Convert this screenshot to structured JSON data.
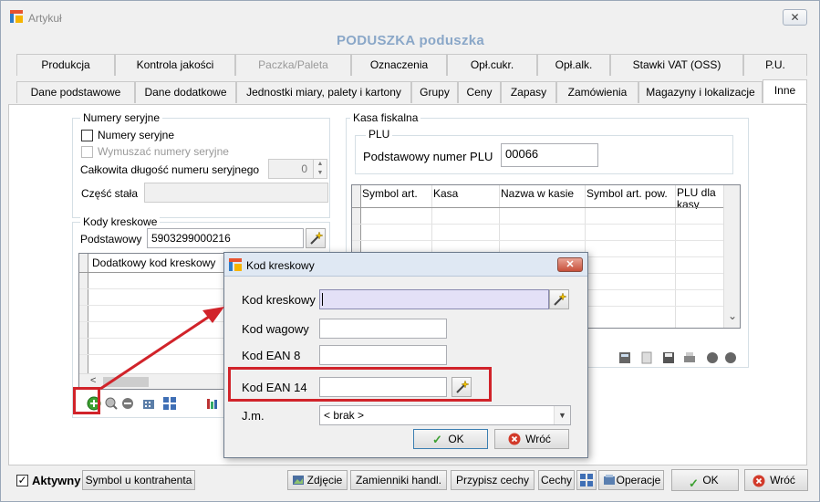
{
  "window": {
    "title": "Artykuł",
    "close_glyph": "✕",
    "product_title": "PODUSZKA  poduszka"
  },
  "tabs_row1": [
    "Produkcja",
    "Kontrola jakości",
    "Paczka/Paleta",
    "Oznaczenia",
    "Opł.cukr.",
    "Opł.alk.",
    "Stawki VAT (OSS)",
    "P.U."
  ],
  "tabs_row2": [
    "Dane podstawowe",
    "Dane dodatkowe",
    "Jednostki miary, palety i kartony",
    "Grupy",
    "Ceny",
    "Zapasy",
    "Zamówienia",
    "Magazyny i lokalizacje",
    "Inne"
  ],
  "serial": {
    "group_title": "Numery seryjne",
    "numery_seryjne_label": "Numery seryjne",
    "wymuszac_label": "Wymuszać numery seryjne",
    "length_label": "Całkowita długość numeru seryjnego",
    "length_value": "0",
    "stala_label": "Część stała",
    "stala_value": ""
  },
  "barcodes": {
    "group_title": "Kody kreskowe",
    "primary_label": "Podstawowy",
    "primary_value": "5903299000216",
    "grid_header": "Dodatkowy kod kreskowy",
    "scroll_left_glyph": "<"
  },
  "fiscal": {
    "group_title": "Kasa fiskalna",
    "plu_group_title": "PLU",
    "plu_label": "Podstawowy numer PLU",
    "plu_value": "00066",
    "columns": [
      "Symbol art.",
      "Kasa",
      "Nazwa w kasie",
      "Symbol art. pow.",
      "PLU dla kasy"
    ],
    "scroll_down_glyph": "⌄"
  },
  "footer": {
    "active_label": "Aktywny",
    "active_checked": true,
    "check_glyph": "✓",
    "symbol_button": "Symbol u kontrahenta",
    "zdjecie_button": "Zdjęcie",
    "zamienniki_button": "Zamienniki handl.",
    "przypisz_button": "Przypisz cechy",
    "cechy_button": "Cechy",
    "operacje_button": "Operacje",
    "ok_button": "OK",
    "wroc_button": "Wróć"
  },
  "dialog": {
    "title": "Kod kreskowy",
    "close_glyph": "✕",
    "kod_kreskowy_label": "Kod kreskowy",
    "kod_kreskowy_value": "",
    "kod_wagowy_label": "Kod wagowy",
    "kod_wagowy_value": "",
    "ean8_label": "Kod EAN 8",
    "ean8_value": "",
    "ean14_label": "Kod EAN 14",
    "ean14_value": "",
    "jm_label": "J.m.",
    "jm_value": "< brak >",
    "ok_button": "OK",
    "wroc_button": "Wróć"
  },
  "colors": {
    "title_blue": "#8aa7c8",
    "highlight_red": "#d1232a",
    "ok_green": "#3da032",
    "cancel_red": "#d23a2a",
    "input_focus": "#e3e0f7"
  }
}
